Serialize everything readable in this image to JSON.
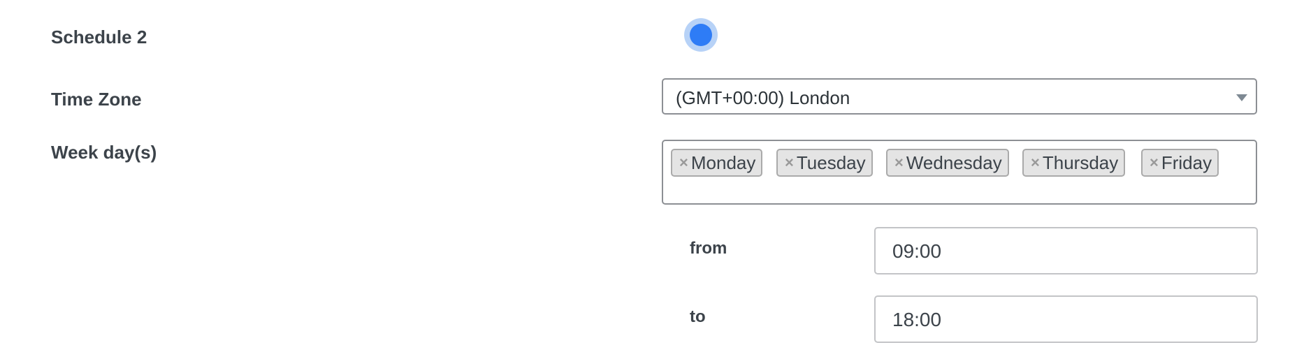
{
  "schedule": {
    "title": "Schedule 2",
    "enabled": true
  },
  "timezone": {
    "label": "Time Zone",
    "value": "(GMT+00:00) London"
  },
  "weekdays": {
    "label": "Week day(s)",
    "remove_glyph": "×",
    "selected": [
      "Monday",
      "Tuesday",
      "Wednesday",
      "Thursday",
      "Friday"
    ]
  },
  "hours": {
    "from_label": "from",
    "from_value": "09:00",
    "to_label": "to",
    "to_value": "18:00"
  },
  "colors": {
    "toggle_on": "#2e7cf6",
    "toggle_halo": "#b7d2f7",
    "chip_bg": "#e4e4e4",
    "text": "#3c434a"
  }
}
